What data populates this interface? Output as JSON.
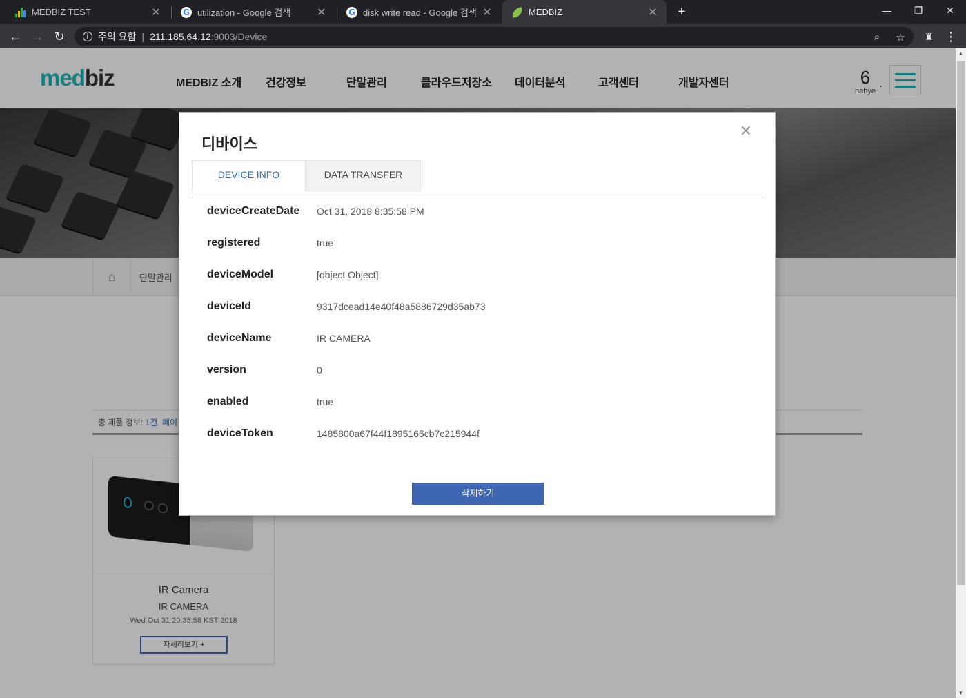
{
  "browser": {
    "tabs": [
      {
        "title": "MEDBIZ TEST",
        "icon": "bar-chart-icon"
      },
      {
        "title": "utilization - Google 검색",
        "icon": "google-icon"
      },
      {
        "title": "disk write read - Google 검색",
        "icon": "google-icon"
      },
      {
        "title": "MEDBIZ",
        "icon": "leaf-icon",
        "active": true
      }
    ],
    "security_warning": "주의 요함",
    "url_host": "211.185.64.12",
    "url_path": ":9003/Device"
  },
  "site": {
    "logo_part1": "med",
    "logo_part2": "biz",
    "nav": [
      "MEDBIZ 소개",
      "건강정보",
      "단말관리",
      "클라우드저장소",
      "데이터분석",
      "고객센터",
      "개발자센터"
    ],
    "user_name": "nahye",
    "breadcrumb": "단말관리",
    "summary_label": "총 제품 정보: ",
    "summary_count": "1건. 페이",
    "card": {
      "title": "IR Camera",
      "subtitle": "IR CAMERA",
      "date": "Wed Oct 31 20:35:58 KST 2018",
      "button": "자세히보기 +"
    }
  },
  "modal": {
    "title": "디바이스",
    "close": "✕",
    "tabs": [
      "DEVICE INFO",
      "DATA TRANSFER"
    ],
    "fields": [
      {
        "key": "deviceCreateDate",
        "value": "Oct 31, 2018 8:35:58 PM"
      },
      {
        "key": "registered",
        "value": "true"
      },
      {
        "key": "deviceModel",
        "value": "[object Object]"
      },
      {
        "key": "deviceId",
        "value": "9317dcead14e40f48a5886729d35ab73"
      },
      {
        "key": "deviceName",
        "value": "IR CAMERA"
      },
      {
        "key": "version",
        "value": "0"
      },
      {
        "key": "enabled",
        "value": "true"
      },
      {
        "key": "deviceToken",
        "value": "1485800a67f44f1895165cb7c215944f"
      }
    ],
    "delete_button": "삭제하기"
  },
  "colors": {
    "brand_teal": "#1bb5b5",
    "button_blue": "#3e66b3",
    "tab_active_text": "#2a6ab3",
    "tab_underline": "#2bb19b"
  }
}
